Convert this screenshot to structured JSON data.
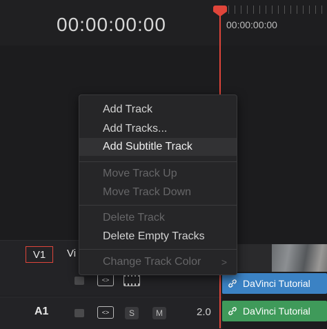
{
  "timeline": {
    "timecode": "00:00:00:00",
    "ruler_time": "00:00:00:00"
  },
  "context_menu": {
    "items": [
      {
        "label": "Add Track",
        "enabled": true
      },
      {
        "label": "Add Tracks...",
        "enabled": true
      },
      {
        "label": "Add Subtitle Track",
        "enabled": true,
        "highlighted": true
      },
      {
        "label": "Move Track Up",
        "enabled": false
      },
      {
        "label": "Move Track Down",
        "enabled": false
      },
      {
        "label": "Delete Track",
        "enabled": false
      },
      {
        "label": "Delete Empty Tracks",
        "enabled": true
      },
      {
        "label": "Change Track Color",
        "enabled": false,
        "submenu_glyph": ">"
      }
    ]
  },
  "tracks": {
    "video": {
      "id": "V1",
      "name": "Vi",
      "code_glyph": "<>"
    },
    "audio": {
      "id": "A1",
      "solo": "S",
      "mute": "M",
      "channels": "2.0",
      "code_glyph": "<>"
    }
  },
  "clips": {
    "video_title": "DaVinci Tutorial",
    "audio_title": "DaVinci Tutorial"
  },
  "colors": {
    "playhead": "#e0453a",
    "video_clip": "#3b82c4",
    "audio_clip": "#3f9a5a",
    "menu_bg": "#262628"
  },
  "icons": {
    "link": "link-icon",
    "lock": "lock-icon",
    "code": "code-icon",
    "film": "film-icon"
  }
}
